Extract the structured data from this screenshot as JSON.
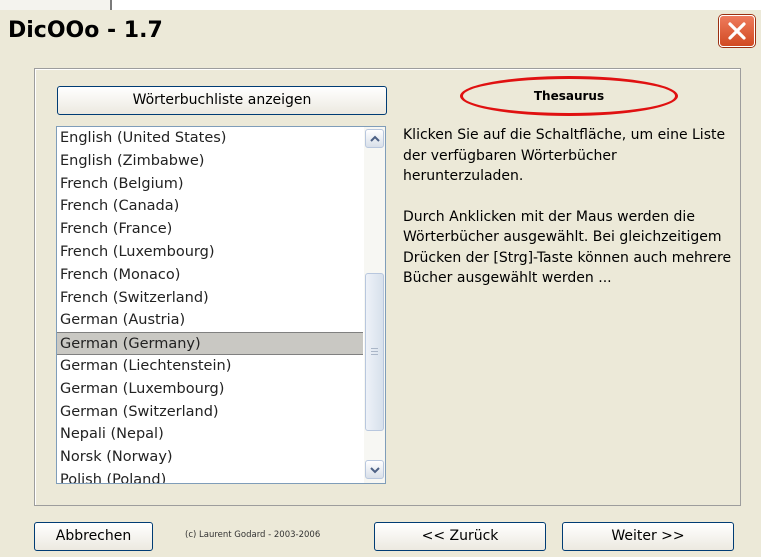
{
  "window": {
    "title": "DicOOo - 1.7"
  },
  "buttons": {
    "show_dictionary_list": "Wörterbuchliste anzeigen",
    "cancel": "Abbrechen",
    "back": "<< Zurück",
    "next": "Weiter >>"
  },
  "mode_label": "Thesaurus",
  "language_list": {
    "items": [
      "English (United States)",
      "English (Zimbabwe)",
      "French (Belgium)",
      "French (Canada)",
      "French (France)",
      "French (Luxembourg)",
      "French (Monaco)",
      "French (Switzerland)",
      "German (Austria)",
      "German (Germany)",
      "German (Liechtenstein)",
      "German (Luxembourg)",
      "German (Switzerland)",
      "Nepali (Nepal)",
      "Norsk (Norway)",
      "Polish (Poland)"
    ],
    "selected": "German (Germany)"
  },
  "info": {
    "paragraph1": "Klicken Sie auf die Schaltfläche, um eine Liste der verfügbaren Wörterbücher herunterzuladen.",
    "paragraph2": "Durch Anklicken mit der Maus werden die Wörterbücher ausgewählt. Bei gleichzeitigem Drücken der [Strg]-Taste können auch mehrere Bücher ausgewählt werden ..."
  },
  "copyright": "(c) Laurent Godard - 2003-2006",
  "colors": {
    "highlight_ellipse": "#e01111",
    "dialog_background": "#ece9d8",
    "selection_background": "#c9c8c3"
  },
  "icons": {
    "close": "close-icon",
    "scroll_up": "chevron-up-icon",
    "scroll_down": "chevron-down-icon"
  }
}
